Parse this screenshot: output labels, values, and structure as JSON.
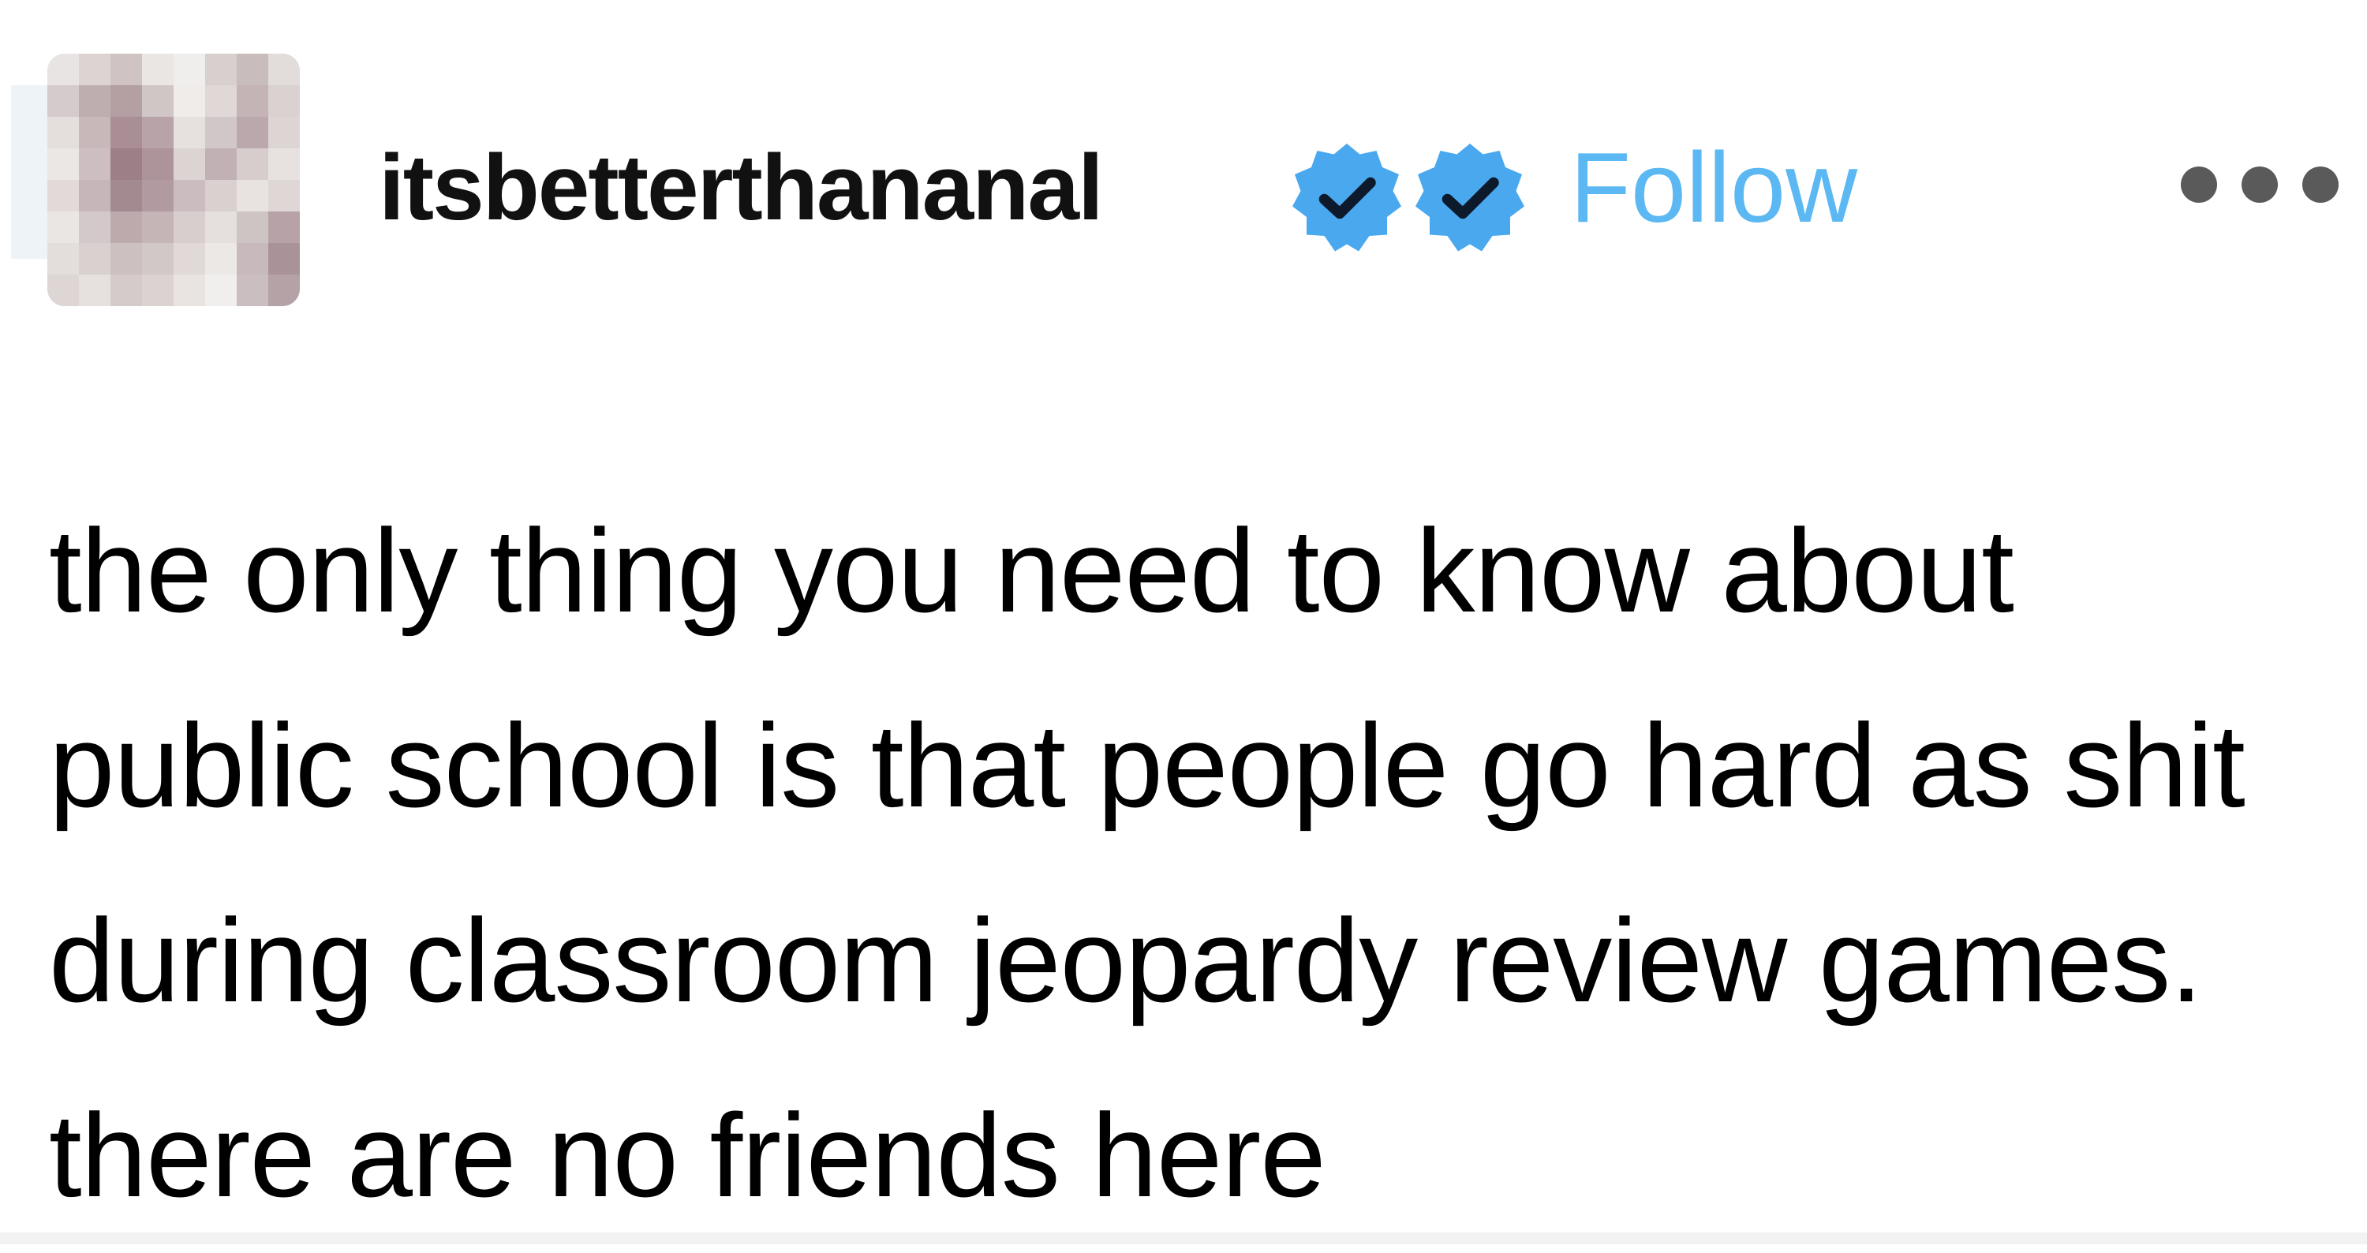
{
  "post": {
    "author": {
      "username": "itsbetterthananal",
      "verified_badges": [
        "verified-check-icon",
        "verified-check-icon"
      ],
      "avatar_icon": "blurred-avatar-image"
    },
    "follow_label": "Follow",
    "more_icon": "ellipsis-icon",
    "text": "the only thing you need to know about public school is that people go hard as shit during classroom jeopardy review games. there are no friends here"
  },
  "colors": {
    "follow": "#5cb8f2",
    "badge": "#4aa8ee",
    "text": "#000000",
    "more_dots": "#5a5a5a"
  }
}
